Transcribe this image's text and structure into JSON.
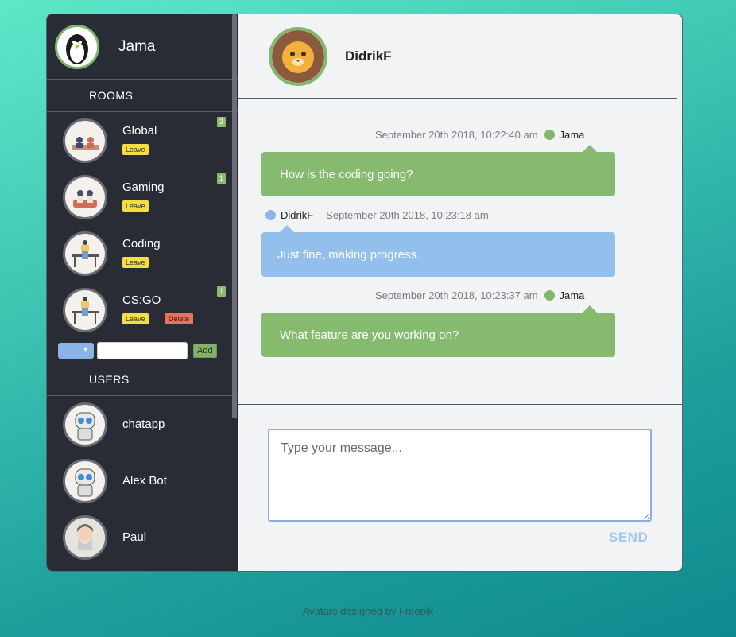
{
  "me": {
    "name": "Jama"
  },
  "sidebar": {
    "rooms_title": "ROOMS",
    "users_title": "USERS",
    "rooms": [
      {
        "name": "Global",
        "leave_label": "Leave",
        "unread": "3"
      },
      {
        "name": "Gaming",
        "leave_label": "Leave",
        "unread": "1"
      },
      {
        "name": "Coding",
        "leave_label": "Leave",
        "unread": ""
      },
      {
        "name": "CS:GO",
        "leave_label": "Leave",
        "delete_label": "Delete",
        "unread": "1"
      }
    ],
    "add_room": {
      "select_value": "",
      "input_value": "",
      "add_label": "Add"
    },
    "users": [
      {
        "name": "chatapp"
      },
      {
        "name": "Alex Bot"
      },
      {
        "name": "Paul"
      }
    ]
  },
  "chat": {
    "peer_name": "DidrikF",
    "messages": [
      {
        "time": "September 20th 2018, 10:22:40 am",
        "author": "Jama",
        "text": "How is the coding going?",
        "direction": "out"
      },
      {
        "time": "September 20th 2018, 10:23:18 am",
        "author": "DidrikF",
        "text": "Just fine, making progress.",
        "direction": "in"
      },
      {
        "time": "September 20th 2018, 10:23:37 am",
        "author": "Jama",
        "text": "What feature are you working on?",
        "direction": "out"
      }
    ],
    "compose_placeholder": "Type your message...",
    "send_label": "SEND"
  },
  "footer": {
    "credit": "Avatars designed by Freepik"
  },
  "icons": {
    "me_avatar": "penguin-avatar-icon",
    "peer_avatar": "lion-avatar-icon",
    "room_avatar": "people-illustration-icon",
    "user_avatar": "robot-avatar-icon",
    "select_arrow": "chevron-down-icon"
  },
  "colors": {
    "sidebar_bg": "#2a2c35",
    "outgoing_bubble": "#86bb6f",
    "incoming_bubble": "#92bfeb",
    "leave_button": "#f3df45",
    "delete_button": "#e9715e",
    "send_text": "#a6c6ed"
  }
}
